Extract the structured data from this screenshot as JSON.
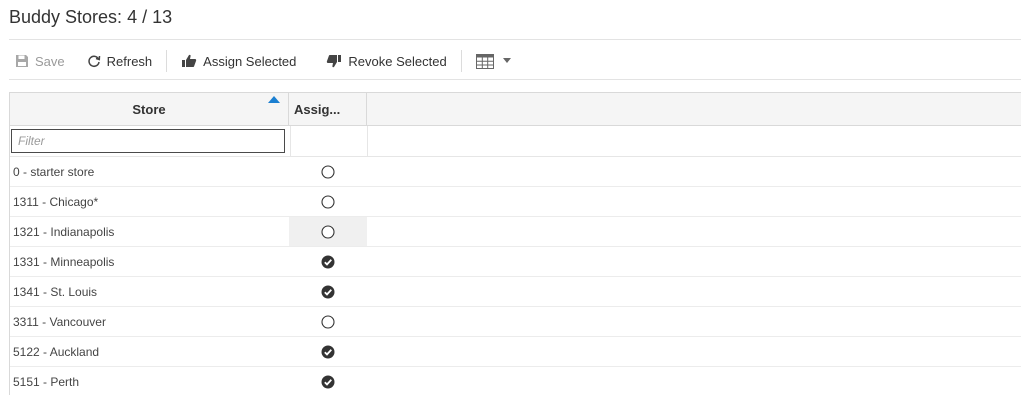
{
  "title": "Buddy Stores: 4 / 13",
  "toolbar": {
    "save_label": "Save",
    "refresh_label": "Refresh",
    "assign_label": "Assign Selected",
    "revoke_label": "Revoke Selected"
  },
  "grid": {
    "columns": [
      "Store",
      "Assig..."
    ],
    "filter_placeholder": "Filter",
    "rows": [
      {
        "store": "0 - starter store",
        "assigned": false
      },
      {
        "store": "1311 - Chicago*",
        "assigned": false
      },
      {
        "store": "1321 - Indianapolis",
        "assigned": false
      },
      {
        "store": "1331 - Minneapolis",
        "assigned": true
      },
      {
        "store": "1341 - St. Louis",
        "assigned": true
      },
      {
        "store": "3311 - Vancouver",
        "assigned": false
      },
      {
        "store": "5122 - Auckland",
        "assigned": true
      },
      {
        "store": "5151 - Perth",
        "assigned": true
      }
    ]
  },
  "colors": {
    "sort_arrow": "#1b7fd1",
    "check_fill": "#333333",
    "disabled_text": "#9a9a9a"
  },
  "icons": {
    "save": "floppy-icon",
    "refresh": "refresh-icon",
    "assign": "thumbs-up-icon",
    "revoke": "thumbs-down-icon",
    "columns": "column-chooser-icon",
    "dropdown": "caret-down-icon",
    "assigned": "check-circle-icon",
    "unassigned": "empty-circle-icon"
  }
}
